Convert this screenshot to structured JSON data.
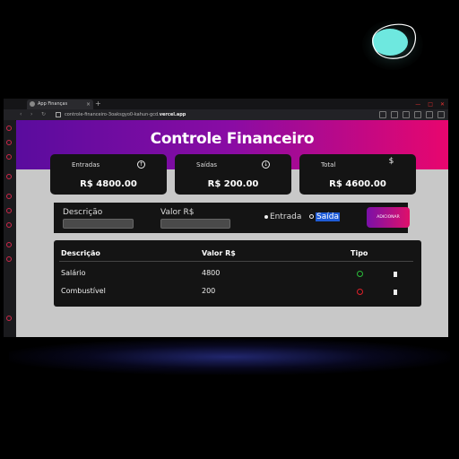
{
  "browser": {
    "tab_title": "App Finanças",
    "new_tab": "+",
    "url_prefix": "controle-financeiro-",
    "url_mid": "3oaksgyo0-kahun-gcd.",
    "url_host": "vercel.app",
    "nav_back": "‹",
    "nav_forward": "›",
    "nav_reload": "↻"
  },
  "app": {
    "title": "Controle Financeiro",
    "cards": [
      {
        "label": "Entradas",
        "value": "R$ 4800.00",
        "icon": "arrow-up-circle-icon",
        "icon_glyph": "↑"
      },
      {
        "label": "Saídas",
        "value": "R$ 200.00",
        "icon": "arrow-down-circle-icon",
        "icon_glyph": "↓"
      },
      {
        "label": "Total",
        "value": "R$ 4600.00",
        "icon": "dollar-icon",
        "icon_glyph": "$"
      }
    ],
    "form": {
      "description_label": "Descrição",
      "value_label": "Valor R$",
      "radio_in": "Entrada",
      "radio_out": "Saída",
      "add_button": "ADICIONAR"
    },
    "table": {
      "headers": [
        "Descrição",
        "Valor R$",
        "Tipo"
      ],
      "rows": [
        {
          "description": "Salário",
          "value": "4800",
          "type": "in"
        },
        {
          "description": "Combustível",
          "value": "200",
          "type": "out"
        }
      ]
    }
  },
  "colors": {
    "gradient_start": "#5a0c9e",
    "gradient_end": "#e8066e",
    "income": "#2bbd3a",
    "expense": "#e0202a",
    "logo_teal": "#6ef0e6"
  }
}
